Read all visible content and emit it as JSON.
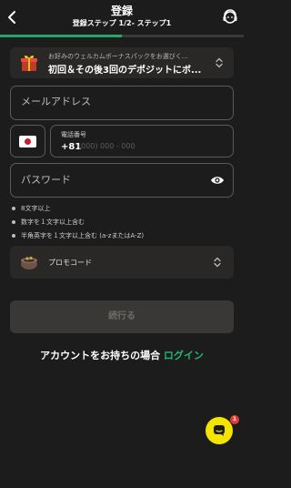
{
  "header": {
    "title": "登録",
    "subtitle": "登録ステップ 1/2- ステップ1",
    "progress": 0.5
  },
  "bonus": {
    "small_text": "お好みのウェルカムボーナスパックをお選びく...",
    "main_text": "初回＆その後3回のデポジットにボ..."
  },
  "form": {
    "email_placeholder": "メールアドレス",
    "phone_label": "電話番号",
    "phone_code": "+81",
    "phone_placeholder": "(000) 000 - 000",
    "country_flag": "jp-flag-icon",
    "password_placeholder": "パスワード"
  },
  "password_rules": [
    "8文字以上",
    "数字を１文字以上含む",
    "半角英字を１文字以上含む (a-zまたはA-Z)"
  ],
  "promo": {
    "label": "プロモコード"
  },
  "continue_label": "続行る",
  "login": {
    "prompt": "アカウントをお持ちの場合",
    "link": "ログイン"
  },
  "chat": {
    "badge": "1"
  },
  "colors": {
    "accent": "#22b573",
    "background": "#1c1c1c",
    "chat": "#f5e400",
    "badge": "#e53935"
  }
}
